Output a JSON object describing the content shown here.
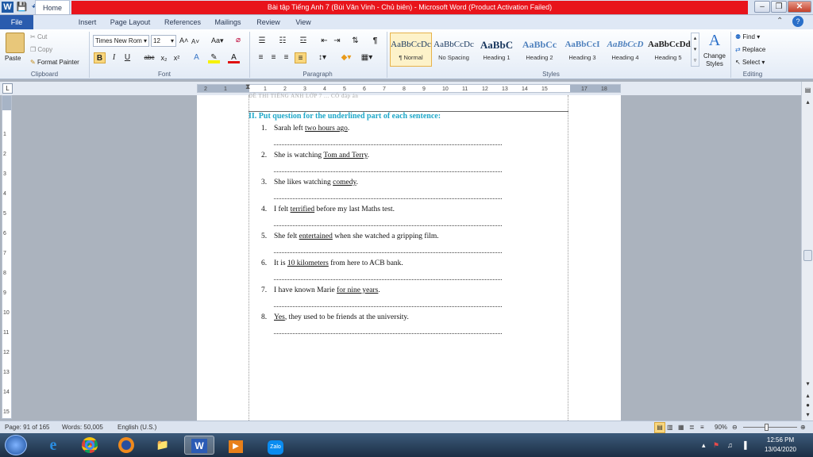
{
  "window": {
    "title": "Bài tập Tiếng Anh 7 (Bùi Văn Vinh - Chủ biên)  -  Microsoft Word (Product Activation Failed)"
  },
  "ribbon_tabs": [
    "File",
    "Home",
    "Insert",
    "Page Layout",
    "References",
    "Mailings",
    "Review",
    "View"
  ],
  "clipboard": {
    "paste": "Paste",
    "cut": "Cut",
    "copy": "Copy",
    "format_painter": "Format Painter",
    "label": "Clipboard"
  },
  "font": {
    "name": "Times New Rom",
    "size": "12",
    "label": "Font"
  },
  "paragraph": {
    "label": "Paragraph"
  },
  "styles": {
    "items": [
      {
        "preview": "AaBbCcDc",
        "name": "¶ Normal"
      },
      {
        "preview": "AaBbCcDc",
        "name": "No Spacing"
      },
      {
        "preview": "AaBbC",
        "name": "Heading 1"
      },
      {
        "preview": "AaBbCc",
        "name": "Heading 2"
      },
      {
        "preview": "AaBbCcI",
        "name": "Heading 3"
      },
      {
        "preview": "AaBbCcD",
        "name": "Heading 4"
      },
      {
        "preview": "AaBbCcDd",
        "name": "Heading 5"
      }
    ],
    "change_styles": "Change Styles",
    "label": "Styles"
  },
  "editing": {
    "find": "Find",
    "replace": "Replace",
    "select": "Select",
    "label": "Editing"
  },
  "document": {
    "header_ghost": "ĐỀ THI TIẾNG ANH LỚP 7 ... CÓ đáp án",
    "section_heading": "II.  Put question for the underlined part of each sentence:",
    "questions": [
      {
        "num": "1.",
        "before": "Sarah left ",
        "underlined": "two hours ago",
        "after": "."
      },
      {
        "num": "2.",
        "before": "She is watching ",
        "underlined": "Tom and Terry",
        "after": "."
      },
      {
        "num": "3.",
        "before": "She likes watching ",
        "underlined": "comedy",
        "after": "."
      },
      {
        "num": "4.",
        "before": "I felt ",
        "underlined": "terrified",
        "after": " before my last Maths test."
      },
      {
        "num": "5.",
        "before": "She felt ",
        "underlined": "entertained",
        "after": " when she watched  a gripping film."
      },
      {
        "num": "6.",
        "before": "It is ",
        "underlined": "10 kilometers",
        "after": " from here to ACB bank."
      },
      {
        "num": "7.",
        "before": "I have known Marie ",
        "underlined": "for nine years",
        "after": "."
      },
      {
        "num": "8.",
        "before": "",
        "underlined": "Yes",
        "after": ", they used to be friends at the university."
      }
    ]
  },
  "status": {
    "page": "Page: 91 of 165",
    "words": "Words: 50,005",
    "language": "English (U.S.)",
    "zoom": "90%"
  },
  "taskbar": {
    "time": "12:56 PM",
    "date": "13/04/2020"
  }
}
